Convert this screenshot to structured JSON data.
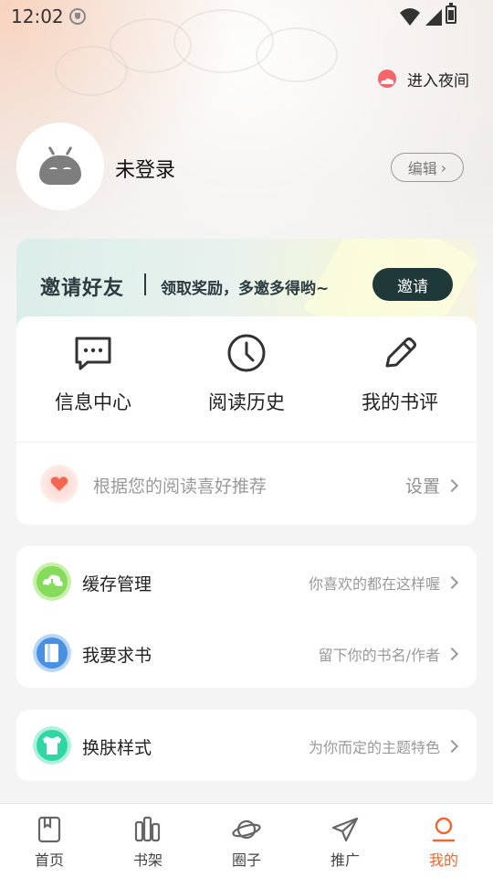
{
  "status_bar": {
    "time": "12:02"
  },
  "header": {
    "night_mode_label": "进入夜间"
  },
  "profile": {
    "name": "未登录",
    "edit_label": "编辑"
  },
  "invite": {
    "title": "邀请好友",
    "subtitle": "领取奖励，多邀多得哟~",
    "button_label": "邀请"
  },
  "quick_actions": [
    {
      "label": "信息中心",
      "icon": "message-icon"
    },
    {
      "label": "阅读历史",
      "icon": "clock-icon"
    },
    {
      "label": "我的书评",
      "icon": "pencil-icon"
    }
  ],
  "recommend": {
    "text": "根据您的阅读喜好推荐",
    "setting_label": "设置"
  },
  "menu": [
    {
      "label": "缓存管理",
      "hint": "你喜欢的都在这样喔",
      "icon": "cloud-download-icon",
      "color": "#7ed957"
    },
    {
      "label": "我要求书",
      "hint": "留下你的书名/作者",
      "icon": "book-icon",
      "color": "#4a90e2"
    },
    {
      "label": "换肤样式",
      "hint": "为你而定的主题特色",
      "icon": "tshirt-icon",
      "color": "#2fd6a6"
    }
  ],
  "tabbar": [
    {
      "label": "首页",
      "icon": "home-book-icon",
      "active": false
    },
    {
      "label": "书架",
      "icon": "bookshelf-icon",
      "active": false
    },
    {
      "label": "圈子",
      "icon": "planet-icon",
      "active": false
    },
    {
      "label": "推广",
      "icon": "paper-plane-icon",
      "active": false
    },
    {
      "label": "我的",
      "icon": "profile-icon",
      "active": true
    }
  ],
  "colors": {
    "accent": "#f2652b",
    "invite_button": "#1f3838"
  }
}
